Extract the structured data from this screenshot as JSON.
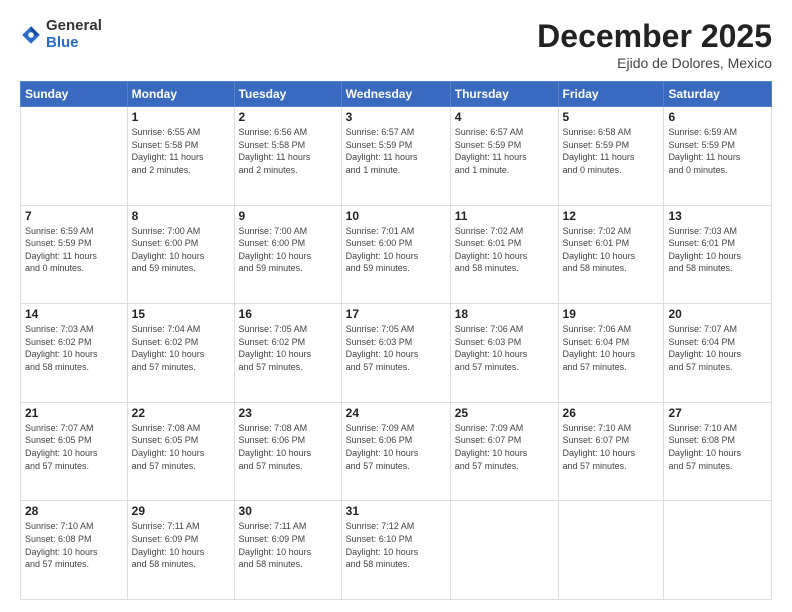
{
  "logo": {
    "general": "General",
    "blue": "Blue"
  },
  "header": {
    "month": "December 2025",
    "location": "Ejido de Dolores, Mexico"
  },
  "days_of_week": [
    "Sunday",
    "Monday",
    "Tuesday",
    "Wednesday",
    "Thursday",
    "Friday",
    "Saturday"
  ],
  "weeks": [
    [
      {
        "day": "",
        "info": ""
      },
      {
        "day": "1",
        "info": "Sunrise: 6:55 AM\nSunset: 5:58 PM\nDaylight: 11 hours\nand 2 minutes."
      },
      {
        "day": "2",
        "info": "Sunrise: 6:56 AM\nSunset: 5:58 PM\nDaylight: 11 hours\nand 2 minutes."
      },
      {
        "day": "3",
        "info": "Sunrise: 6:57 AM\nSunset: 5:59 PM\nDaylight: 11 hours\nand 1 minute."
      },
      {
        "day": "4",
        "info": "Sunrise: 6:57 AM\nSunset: 5:59 PM\nDaylight: 11 hours\nand 1 minute."
      },
      {
        "day": "5",
        "info": "Sunrise: 6:58 AM\nSunset: 5:59 PM\nDaylight: 11 hours\nand 0 minutes."
      },
      {
        "day": "6",
        "info": "Sunrise: 6:59 AM\nSunset: 5:59 PM\nDaylight: 11 hours\nand 0 minutes."
      }
    ],
    [
      {
        "day": "7",
        "info": "Sunrise: 6:59 AM\nSunset: 5:59 PM\nDaylight: 11 hours\nand 0 minutes."
      },
      {
        "day": "8",
        "info": "Sunrise: 7:00 AM\nSunset: 6:00 PM\nDaylight: 10 hours\nand 59 minutes."
      },
      {
        "day": "9",
        "info": "Sunrise: 7:00 AM\nSunset: 6:00 PM\nDaylight: 10 hours\nand 59 minutes."
      },
      {
        "day": "10",
        "info": "Sunrise: 7:01 AM\nSunset: 6:00 PM\nDaylight: 10 hours\nand 59 minutes."
      },
      {
        "day": "11",
        "info": "Sunrise: 7:02 AM\nSunset: 6:01 PM\nDaylight: 10 hours\nand 58 minutes."
      },
      {
        "day": "12",
        "info": "Sunrise: 7:02 AM\nSunset: 6:01 PM\nDaylight: 10 hours\nand 58 minutes."
      },
      {
        "day": "13",
        "info": "Sunrise: 7:03 AM\nSunset: 6:01 PM\nDaylight: 10 hours\nand 58 minutes."
      }
    ],
    [
      {
        "day": "14",
        "info": "Sunrise: 7:03 AM\nSunset: 6:02 PM\nDaylight: 10 hours\nand 58 minutes."
      },
      {
        "day": "15",
        "info": "Sunrise: 7:04 AM\nSunset: 6:02 PM\nDaylight: 10 hours\nand 57 minutes."
      },
      {
        "day": "16",
        "info": "Sunrise: 7:05 AM\nSunset: 6:02 PM\nDaylight: 10 hours\nand 57 minutes."
      },
      {
        "day": "17",
        "info": "Sunrise: 7:05 AM\nSunset: 6:03 PM\nDaylight: 10 hours\nand 57 minutes."
      },
      {
        "day": "18",
        "info": "Sunrise: 7:06 AM\nSunset: 6:03 PM\nDaylight: 10 hours\nand 57 minutes."
      },
      {
        "day": "19",
        "info": "Sunrise: 7:06 AM\nSunset: 6:04 PM\nDaylight: 10 hours\nand 57 minutes."
      },
      {
        "day": "20",
        "info": "Sunrise: 7:07 AM\nSunset: 6:04 PM\nDaylight: 10 hours\nand 57 minutes."
      }
    ],
    [
      {
        "day": "21",
        "info": "Sunrise: 7:07 AM\nSunset: 6:05 PM\nDaylight: 10 hours\nand 57 minutes."
      },
      {
        "day": "22",
        "info": "Sunrise: 7:08 AM\nSunset: 6:05 PM\nDaylight: 10 hours\nand 57 minutes."
      },
      {
        "day": "23",
        "info": "Sunrise: 7:08 AM\nSunset: 6:06 PM\nDaylight: 10 hours\nand 57 minutes."
      },
      {
        "day": "24",
        "info": "Sunrise: 7:09 AM\nSunset: 6:06 PM\nDaylight: 10 hours\nand 57 minutes."
      },
      {
        "day": "25",
        "info": "Sunrise: 7:09 AM\nSunset: 6:07 PM\nDaylight: 10 hours\nand 57 minutes."
      },
      {
        "day": "26",
        "info": "Sunrise: 7:10 AM\nSunset: 6:07 PM\nDaylight: 10 hours\nand 57 minutes."
      },
      {
        "day": "27",
        "info": "Sunrise: 7:10 AM\nSunset: 6:08 PM\nDaylight: 10 hours\nand 57 minutes."
      }
    ],
    [
      {
        "day": "28",
        "info": "Sunrise: 7:10 AM\nSunset: 6:08 PM\nDaylight: 10 hours\nand 57 minutes."
      },
      {
        "day": "29",
        "info": "Sunrise: 7:11 AM\nSunset: 6:09 PM\nDaylight: 10 hours\nand 58 minutes."
      },
      {
        "day": "30",
        "info": "Sunrise: 7:11 AM\nSunset: 6:09 PM\nDaylight: 10 hours\nand 58 minutes."
      },
      {
        "day": "31",
        "info": "Sunrise: 7:12 AM\nSunset: 6:10 PM\nDaylight: 10 hours\nand 58 minutes."
      },
      {
        "day": "",
        "info": ""
      },
      {
        "day": "",
        "info": ""
      },
      {
        "day": "",
        "info": ""
      }
    ]
  ]
}
